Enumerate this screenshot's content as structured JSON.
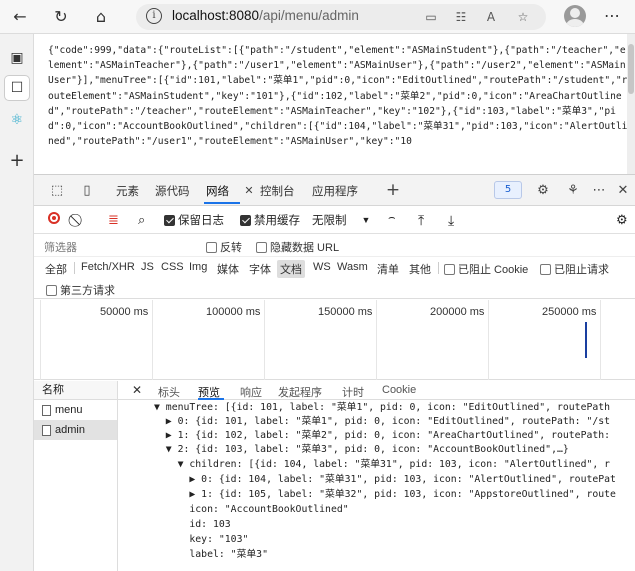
{
  "browser": {
    "url_host": "localhost:8080",
    "url_path": "/api/menu/admin"
  },
  "json_body": "{\"code\":999,\"data\":{\"routeList\":[{\"path\":\"/student\",\"element\":\"ASMainStudent\"},{\"path\":\"/teacher\",\"element\":\"ASMainTeacher\"},{\"path\":\"/user1\",\"element\":\"ASMainUser\"},{\"path\":\"/user2\",\"element\":\"ASMainUser\"}],\"menuTree\":[{\"id\":101,\"label\":\"菜单1\",\"pid\":0,\"icon\":\"EditOutlined\",\"routePath\":\"/student\",\"routeElement\":\"ASMainStudent\",\"key\":\"101\"},{\"id\":102,\"label\":\"菜单2\",\"pid\":0,\"icon\":\"AreaChartOutlined\",\"routePath\":\"/teacher\",\"routeElement\":\"ASMainTeacher\",\"key\":\"102\"},{\"id\":103,\"label\":\"菜单3\",\"pid\":0,\"icon\":\"AccountBookOutlined\",\"children\":[{\"id\":104,\"label\":\"菜单31\",\"pid\":103,\"icon\":\"AlertOutlined\",\"routePath\":\"/user1\",\"routeElement\":\"ASMainUser\",\"key\":\"10",
  "devtools": {
    "tabs": [
      "元素",
      "源代码",
      "网络",
      "控制台",
      "应用程序"
    ],
    "active_tab": "网络",
    "badge_count": "5",
    "toolbar": {
      "preserve_log": "保留日志",
      "disable_cache": "禁用缓存",
      "throttle": "无限制"
    },
    "filter": {
      "label": "筛选器",
      "invert": "反转",
      "hide_data_urls": "隐藏数据 URL"
    },
    "types": [
      "全部",
      "Fetch/XHR",
      "JS",
      "CSS",
      "Img",
      "媒体",
      "字体",
      "文档",
      "WS",
      "Wasm",
      "清单",
      "其他"
    ],
    "active_type": "文档",
    "blocked_cookies": "已阻止 Cookie",
    "blocked_requests": "已阻止请求",
    "third_party": "第三方请求",
    "timeline_ticks": [
      "50000 ms",
      "100000 ms",
      "150000 ms",
      "200000 ms",
      "250000 ms"
    ],
    "list_header": "名称",
    "requests": [
      "menu",
      "admin"
    ],
    "selected_request": "admin",
    "detail_tabs": [
      "标头",
      "预览",
      "响应",
      "发起程序",
      "计时",
      "Cookie"
    ],
    "active_detail_tab": "预览",
    "preview_lines": [
      "▼ menuTree: [{id: 101, label: \"菜单1\", pid: 0, icon: \"EditOutlined\", routePath",
      "  ▶ 0: {id: 101, label: \"菜单1\", pid: 0, icon: \"EditOutlined\", routePath: \"/st",
      "  ▶ 1: {id: 102, label: \"菜单2\", pid: 0, icon: \"AreaChartOutlined\", routePath:",
      "  ▼ 2: {id: 103, label: \"菜单3\", pid: 0, icon: \"AccountBookOutlined\",…}",
      "    ▼ children: [{id: 104, label: \"菜单31\", pid: 103, icon: \"AlertOutlined\", r",
      "      ▶ 0: {id: 104, label: \"菜单31\", pid: 103, icon: \"AlertOutlined\", routePat",
      "      ▶ 1: {id: 105, label: \"菜单32\", pid: 103, icon: \"AppstoreOutlined\", route",
      "      icon: \"AccountBookOutlined\"",
      "      id: 103",
      "      key: \"103\"",
      "      label: \"菜单3\""
    ]
  }
}
